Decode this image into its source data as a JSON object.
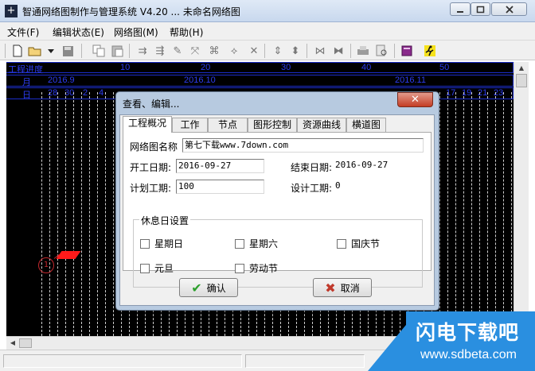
{
  "window": {
    "title": "智通网络图制作与管理系统 V4.20 ... 未命名网络图",
    "app_icon": "plus-cross-icon"
  },
  "menu": [
    "文件(F)",
    "编辑状态(E)",
    "网络图(M)",
    "帮助(H)"
  ],
  "toolbar_icons": [
    "new-file-icon",
    "open-folder-icon",
    "dropdown-arrow-icon",
    "save-icon",
    "copy-icon",
    "paste-icon",
    "insert-icon",
    "insert-node-icon",
    "edit-pen-icon",
    "move-icon",
    "link-icon",
    "delete-icon",
    "align-vertical-icon",
    "align-center-icon",
    "flip-left-icon",
    "flip-right-icon",
    "print-icon",
    "print-preview-icon",
    "book-icon",
    "exit-runner-icon"
  ],
  "canvas": {
    "row_labels": {
      "progress": "工程进度",
      "month": "月",
      "day": "日"
    },
    "progress_ticks": [
      "10",
      "20",
      "30",
      "40",
      "50"
    ],
    "months": [
      "2016.9",
      "2016.10",
      "2016.11"
    ],
    "days_left": [
      "28",
      "30",
      "2",
      "4"
    ],
    "days_right": [
      "17",
      "19",
      "21",
      "23"
    ],
    "node_number": "1",
    "colors": {
      "background": "#000000",
      "grid": "#1b2dc8",
      "marker": "#ff1a1a"
    }
  },
  "dialog": {
    "title": "查看、编辑...",
    "close": "✕",
    "tabs": [
      "工程概况",
      "工作",
      "节点",
      "图形控制",
      "资源曲线",
      "横道图"
    ],
    "active_tab": "工程概况",
    "fields": {
      "name_label": "网络图名称",
      "name_value": "第七下载www.7down.com",
      "start_label": "开工日期:",
      "start_value": "2016-09-27",
      "end_label": "结束日期:",
      "end_value": "2016-09-27",
      "plan_label": "计划工期:",
      "plan_value": "100",
      "design_label": "设计工期:",
      "design_value": "0"
    },
    "holiday_group": {
      "title": "休息日设置",
      "options": [
        "星期日",
        "星期六",
        "国庆节",
        "元旦",
        "劳动节"
      ]
    },
    "ok_label": "确认",
    "cancel_label": "取消"
  },
  "watermark": {
    "title": "闪电下载吧",
    "url": "www.sdbeta.com"
  }
}
